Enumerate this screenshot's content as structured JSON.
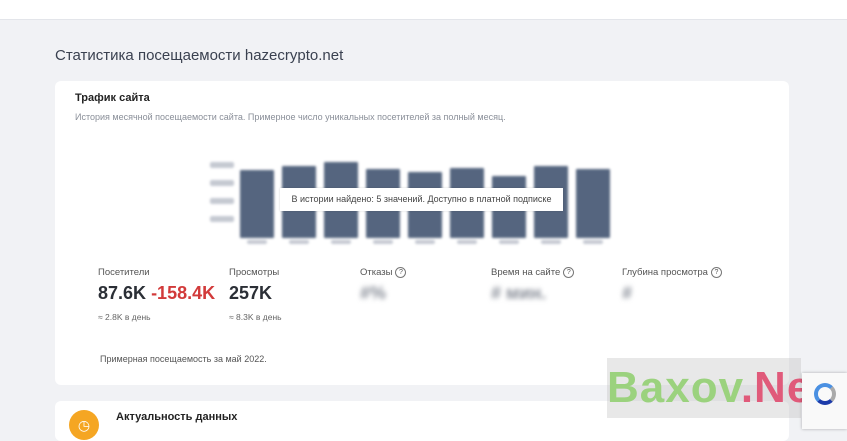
{
  "page": {
    "title": "Статистика посещаемости hazecrypto.net"
  },
  "traffic_card": {
    "title": "Трафик сайта",
    "description": "История месячной посещаемости сайта. Примерное число уникальных посетителей за полный месяц.",
    "tooltip": "В истории найдено: 5 значений. Доступно в платной подписке"
  },
  "chart_data": {
    "type": "bar",
    "values": [
      0.85,
      0.9,
      0.95,
      0.86,
      0.82,
      0.87,
      0.78,
      0.9,
      0.86
    ],
    "note": "blurred"
  },
  "metrics": {
    "visitors": {
      "label": "Посетители",
      "value": "87.6K",
      "delta": "-158.4K",
      "sub": "≈ 2.8K в день"
    },
    "views": {
      "label": "Просмотры",
      "value": "257K",
      "sub": "≈ 8.3K в день"
    },
    "bounce": {
      "label": "Отказы",
      "value": "#%"
    },
    "time": {
      "label": "Время на сайте",
      "value": "# мин."
    },
    "depth": {
      "label": "Глубина просмотра",
      "value": "#"
    }
  },
  "footnote": "Примерная посещаемость за май 2022.",
  "freshness_card": {
    "title": "Актуальность данных",
    "icon": "clock-icon"
  },
  "watermark": {
    "part1": "Baxov",
    "part2": ".Net"
  },
  "colors": {
    "bar": "#55657f",
    "negative": "#d23a3a",
    "accent": "#f5a623"
  }
}
